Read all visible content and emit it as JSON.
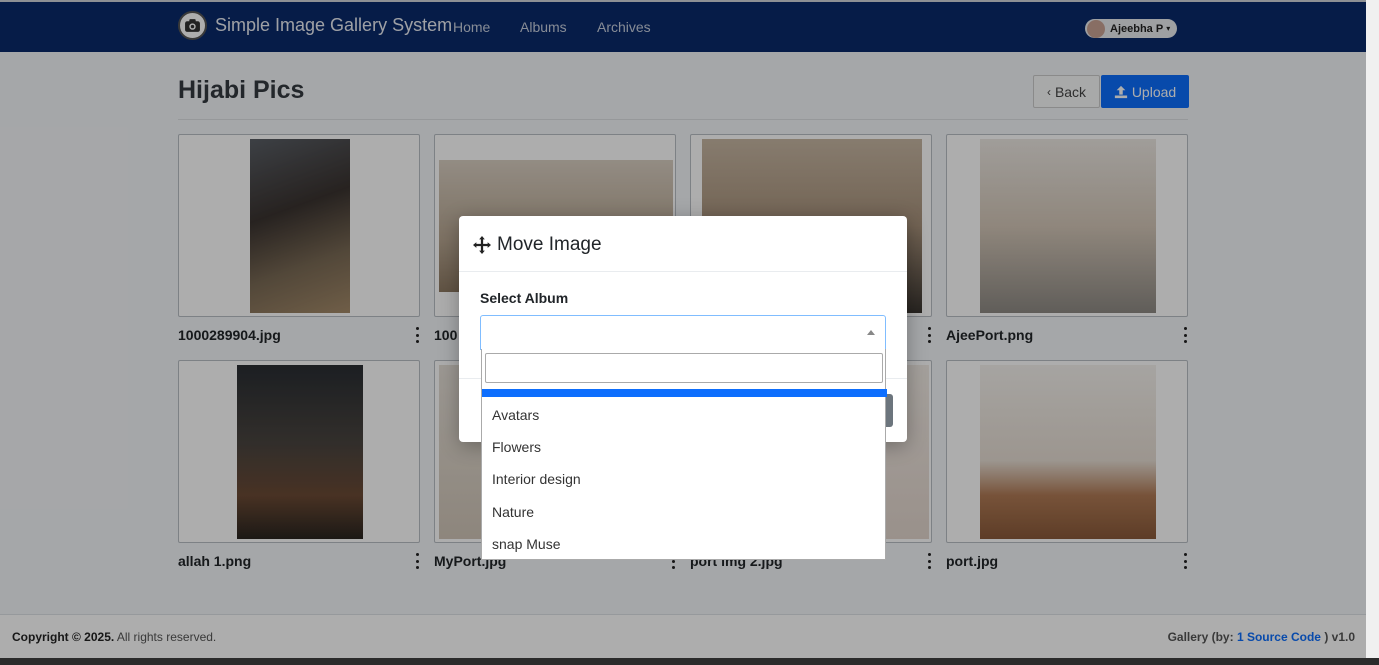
{
  "navbar": {
    "brand": "Simple Image Gallery System",
    "links": [
      "Home",
      "Albums",
      "Archives"
    ],
    "user": "Ajeebha P"
  },
  "page": {
    "title": "Hijabi Pics",
    "back_label": "Back",
    "upload_label": "Upload"
  },
  "images": [
    {
      "caption": "1000289904.jpg"
    },
    {
      "caption": "100"
    },
    {
      "caption": ""
    },
    {
      "caption": "AjeePort.png"
    },
    {
      "caption": "allah 1.png"
    },
    {
      "caption": "MyPort.jpg"
    },
    {
      "caption": "port img 2.jpg"
    },
    {
      "caption": "port.jpg"
    }
  ],
  "modal": {
    "title": "Move Image",
    "label": "Select Album",
    "options": [
      "Avatars",
      "Flowers",
      "Interior design",
      "Nature",
      "snap Muse"
    ]
  },
  "footer": {
    "copyright": "Copyright © 2025.",
    "rights": "All rights reserved.",
    "credit_prefix": "Gallery (by:",
    "credit_link": "1 Source Code",
    "credit_suffix": ") v1.0"
  },
  "colors": {
    "navbar": "#0a2a6b",
    "accent": "#0d6efd"
  }
}
